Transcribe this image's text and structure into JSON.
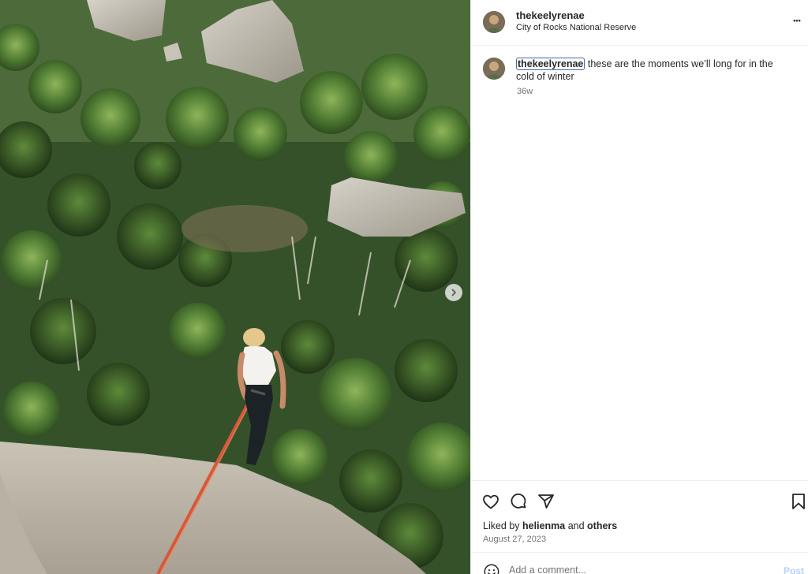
{
  "post": {
    "username": "thekeelyrenae",
    "location": "City of Rocks National Reserve",
    "more_icon": "more-horizontal-icon",
    "more_label": "•••"
  },
  "caption": {
    "username": "thekeelyrenae",
    "text": " these are the moments we’ll long for in the cold of winter",
    "time": "36w"
  },
  "actions": {
    "icons": [
      "heart-icon",
      "comment-icon",
      "share-icon",
      "bookmark-icon"
    ],
    "liked_prefix": "Liked by ",
    "liked_user": "helienma",
    "liked_middle": " and ",
    "liked_others": "others",
    "date": "August 27, 2023"
  },
  "comment": {
    "placeholder": "Add a comment...",
    "post_label": "Post"
  },
  "media": {
    "next_icon": "chevron-right-icon"
  }
}
